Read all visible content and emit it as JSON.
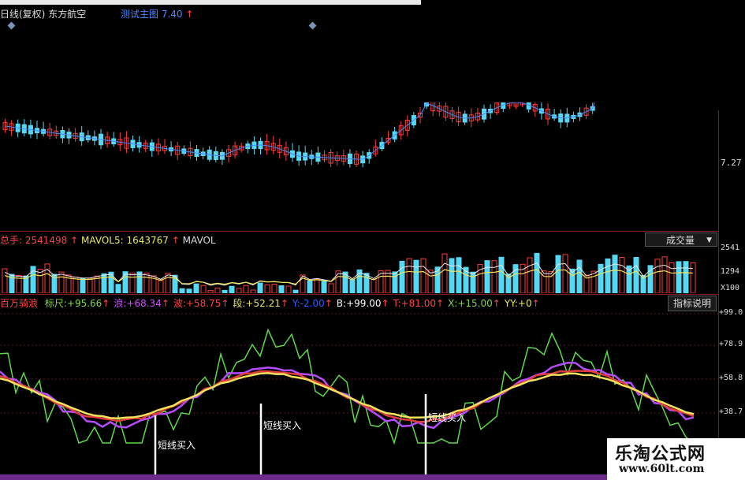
{
  "title_bar": {
    "period": "日线(复权)",
    "stock_name": "东方航空",
    "test_label": "测试主图",
    "test_value": "7.40",
    "up_arrow": "↑"
  },
  "price_axis": {
    "label": "7.27"
  },
  "volume_panel": {
    "total_label": "总手:",
    "total_value": "2541498",
    "mavol5_label": "MAVOL5:",
    "mavol5_value": "1643767",
    "mavol10_label": "MAVOL",
    "dropdown_label": "成交量",
    "axis_labels": [
      "2541",
      "1294",
      "X100"
    ]
  },
  "indicator_panel": {
    "name": "百万骑浪",
    "fields": [
      {
        "label": "标尺:",
        "value": "+95.66",
        "color": "#7cd84a"
      },
      {
        "label": "浪:",
        "value": "+68.34",
        "color": "#d050ff"
      },
      {
        "label": "波:",
        "value": "+58.75",
        "color": "#ff4444"
      },
      {
        "label": "段:",
        "value": "+52.21",
        "color": "#e8e860"
      },
      {
        "label": "Y:",
        "value": "-2.00",
        "color": "#2d5cff"
      },
      {
        "label": "B:",
        "value": "+99.00",
        "color": "#ffffff"
      },
      {
        "label": "T:",
        "value": "+81.00",
        "color": "#ff4444"
      },
      {
        "label": "X:",
        "value": "+15.00",
        "color": "#7cd84a"
      },
      {
        "label": "YY:",
        "value": "+0",
        "color": "#e8e860"
      }
    ],
    "explain_button": "指标说明",
    "axis_labels": [
      "+99.0",
      "+78.9",
      "+58.8",
      "+38.7"
    ],
    "buy_signal": "短线买入"
  },
  "watermark": {
    "cn": "乐淘公式网",
    "url": "www.60lt.com"
  },
  "colors": {
    "up": "#ff3b3b",
    "down": "#54d8f4",
    "ma_white": "#e8e8e8",
    "ma_yellow": "#f4e25a",
    "ma_purple": "#b64bff",
    "ma_red": "#e03c3c",
    "ma_green": "#5fd84a",
    "ma_blue": "#4d86ff"
  }
}
